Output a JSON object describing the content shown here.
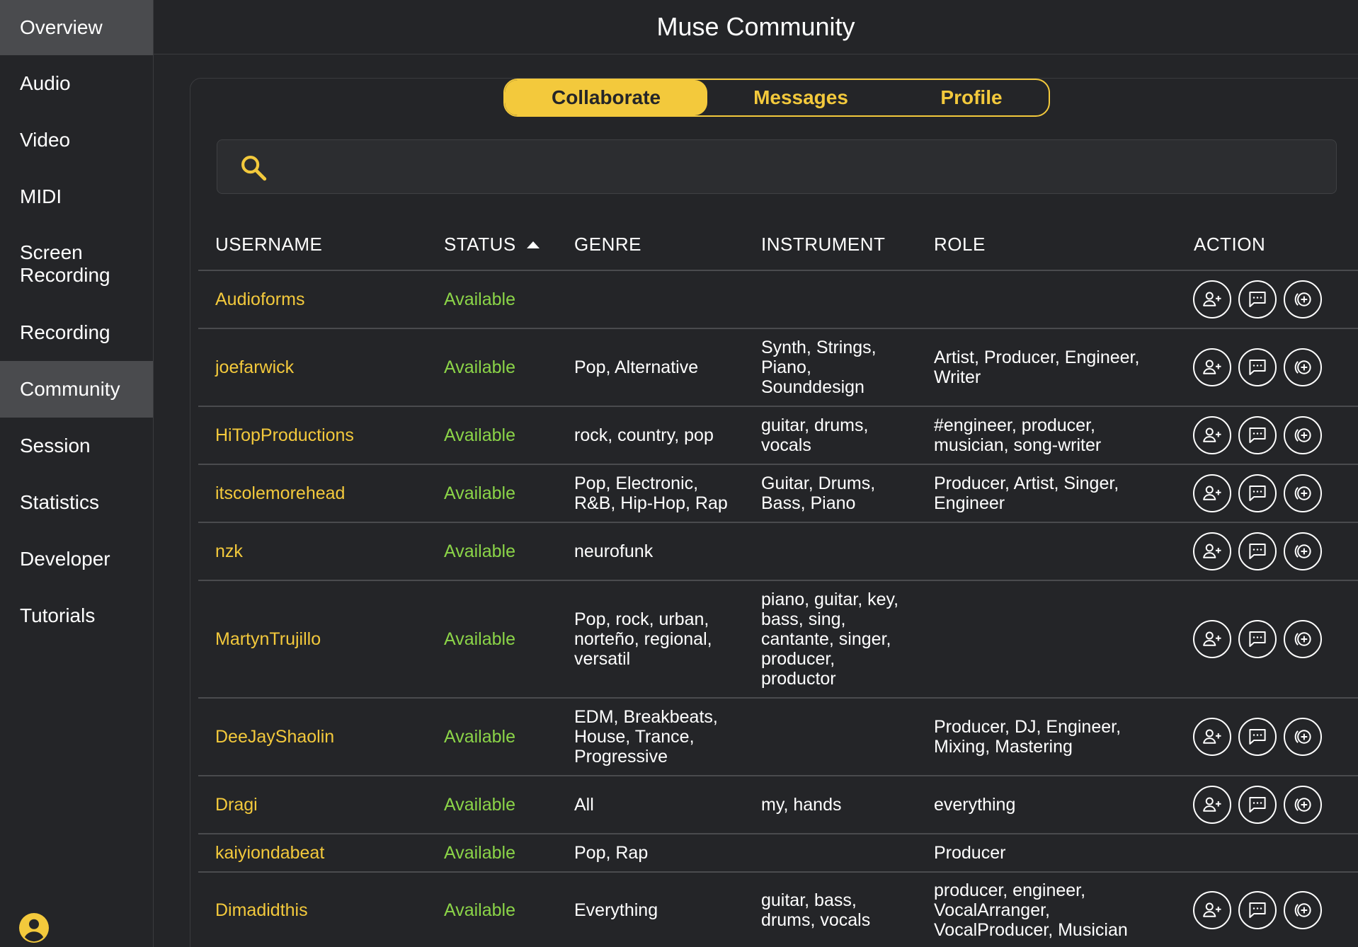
{
  "sidebar": {
    "items": [
      {
        "label": "Overview"
      },
      {
        "label": "Audio"
      },
      {
        "label": "Video"
      },
      {
        "label": "MIDI"
      },
      {
        "label": "Screen\nRecording"
      },
      {
        "label": "Recording"
      },
      {
        "label": "Community"
      },
      {
        "label": "Session"
      },
      {
        "label": "Statistics"
      },
      {
        "label": "Developer"
      },
      {
        "label": "Tutorials"
      }
    ],
    "active": "Community",
    "avatar_icon": "account-circle-icon"
  },
  "header": {
    "title": "Muse Community"
  },
  "tabs": [
    {
      "label": "Collaborate",
      "active": true
    },
    {
      "label": "Messages",
      "active": false
    },
    {
      "label": "Profile",
      "active": false
    }
  ],
  "search": {
    "icon": "search-icon",
    "placeholder": "",
    "value": ""
  },
  "table": {
    "columns": [
      "USERNAME",
      "STATUS",
      "GENRE",
      "INSTRUMENT",
      "ROLE",
      "ACTION"
    ],
    "sort_column": "STATUS",
    "sort_direction": "ascending",
    "action_icons": [
      "add-user-icon",
      "message-icon",
      "collaborate-icon"
    ],
    "rows": [
      {
        "username": "Audioforms",
        "status": "Available",
        "genre": "",
        "instrument": "",
        "role": "",
        "actions": true
      },
      {
        "username": "joefarwick",
        "status": "Available",
        "genre": "Pop, Alternative",
        "instrument": "Synth, Strings,\nPiano,\nSounddesign",
        "role": "Artist, Producer, Engineer,\nWriter",
        "actions": true
      },
      {
        "username": "HiTopProductions",
        "status": "Available",
        "genre": "rock, country, pop",
        "instrument": "guitar, drums,\nvocals",
        "role": "#engineer, producer,\nmusician, song-writer",
        "actions": true
      },
      {
        "username": "itscolemorehead",
        "status": "Available",
        "genre": "Pop, Electronic,\nR&B, Hip-Hop, Rap",
        "instrument": "Guitar, Drums,\nBass, Piano",
        "role": "Producer, Artist, Singer,\nEngineer",
        "actions": true
      },
      {
        "username": "nzk",
        "status": "Available",
        "genre": "neurofunk",
        "instrument": "",
        "role": "",
        "actions": true
      },
      {
        "username": "MartynTrujillo",
        "status": "Available",
        "genre": "Pop, rock, urban,\nnorteño, regional,\nversatil",
        "instrument": "piano, guitar, key,\nbass, sing,\ncantante, singer,\nproducer,\nproductor",
        "role": "",
        "actions": true
      },
      {
        "username": "DeeJayShaolin",
        "status": "Available",
        "genre": "EDM, Breakbeats,\nHouse, Trance,\nProgressive",
        "instrument": "",
        "role": "Producer, DJ, Engineer,\nMixing, Mastering",
        "actions": true
      },
      {
        "username": "Dragi",
        "status": "Available",
        "genre": "All",
        "instrument": "my, hands",
        "role": "everything",
        "actions": true
      },
      {
        "username": "kaiyiondabeat",
        "status": "Available",
        "genre": "Pop, Rap",
        "instrument": "",
        "role": "Producer",
        "actions": false
      },
      {
        "username": "Dimadidthis",
        "status": "Available",
        "genre": "Everything",
        "instrument": "guitar, bass,\ndrums, vocals",
        "role": "producer, engineer,\nVocalArranger,\nVocalProducer, Musician",
        "actions": true
      }
    ]
  },
  "colors": {
    "background": "#242528",
    "accent": "#f3c93c",
    "status_available": "#8bd448",
    "active_nav": "#4a4b4e"
  }
}
